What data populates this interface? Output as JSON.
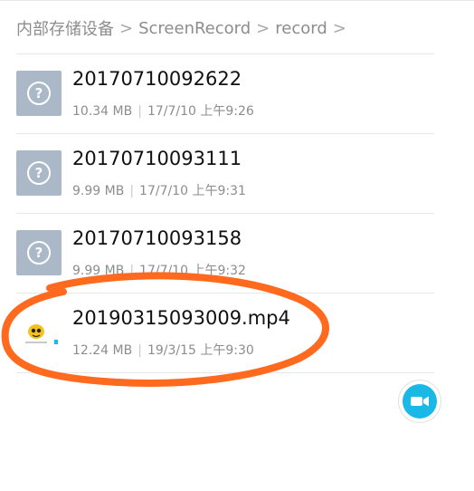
{
  "breadcrumb": {
    "items": [
      "内部存储设备",
      "ScreenRecord",
      "record"
    ],
    "separator": ">"
  },
  "files": [
    {
      "name": "20170710092622",
      "size": "10.34 MB",
      "date": "17/7/10 上午9:26",
      "icon": "unknown-file-icon"
    },
    {
      "name": "20170710093111",
      "size": "9.99 MB",
      "date": "17/7/10 上午9:31",
      "icon": "unknown-file-icon"
    },
    {
      "name": "20170710093158",
      "size": "9.99 MB",
      "date": "17/7/10 上午9:32",
      "icon": "unknown-file-icon"
    },
    {
      "name": "20190315093009.mp4",
      "size": "12.24 MB",
      "date": "19/3/15 上午9:30",
      "icon": "video-thumbnail-icon"
    }
  ],
  "fab": {
    "icon": "camera-icon"
  },
  "colors": {
    "accent": "#19b8e6",
    "annotation": "#ff6a1f",
    "thumb": "#aab8c8",
    "text_secondary": "#8d8d8d"
  }
}
